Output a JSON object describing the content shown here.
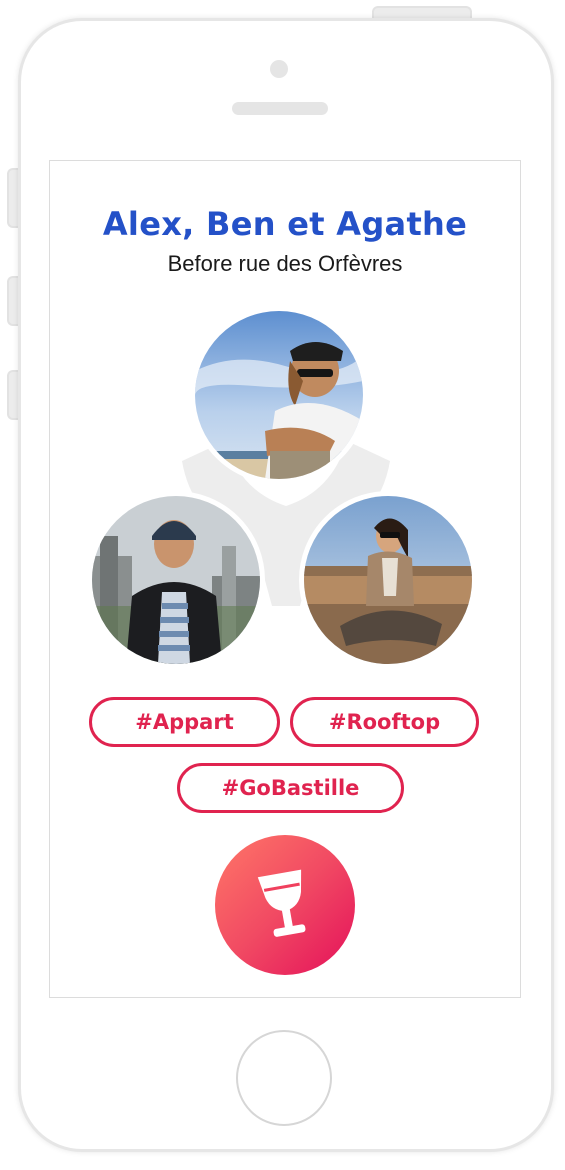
{
  "event": {
    "title": "Alex, Ben et Agathe",
    "subtitle": "Before rue des Orfèvres"
  },
  "participants": [
    {
      "name": "Alex",
      "photo": "man-with-cap-at-beach"
    },
    {
      "name": "Ben",
      "photo": "man-in-beanie-city-view"
    },
    {
      "name": "Agathe",
      "photo": "woman-on-rooftop"
    }
  ],
  "tags": [
    "#Appart",
    "#Rooftop",
    "#GoBastille"
  ],
  "action_button": {
    "icon": "wine-glass-icon"
  },
  "colors": {
    "title": "#2451c8",
    "tag": "#e0234f",
    "button_gradient_start": "#ff7767",
    "button_gradient_end": "#e4105a",
    "connector": "#ededed"
  }
}
